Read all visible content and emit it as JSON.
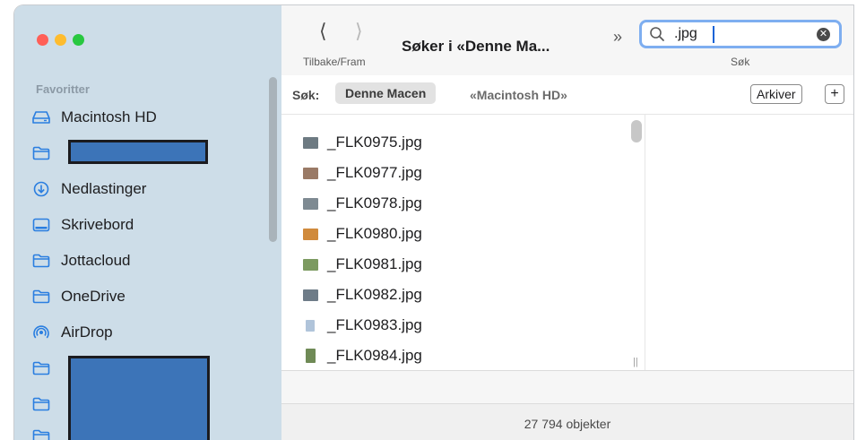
{
  "window": {
    "title": "Søker i «Denne Ma...",
    "nav_label": "Tilbake/Fram",
    "overflow_glyph": "»"
  },
  "search": {
    "query": ".jpg",
    "label": "Søk"
  },
  "scope": {
    "label": "Søk:",
    "active": "Denne Macen",
    "alt": "«Macintosh HD»",
    "save_button": "Arkiver",
    "add_button": "+"
  },
  "sidebar": {
    "header": "Favoritter",
    "items": [
      {
        "label": "Macintosh HD",
        "icon": "drive-icon"
      },
      {
        "label": "",
        "icon": "folder-icon"
      },
      {
        "label": "Nedlastinger",
        "icon": "download-icon"
      },
      {
        "label": "Skrivebord",
        "icon": "desktop-icon"
      },
      {
        "label": "Jottacloud",
        "icon": "folder-icon"
      },
      {
        "label": "OneDrive",
        "icon": "folder-icon"
      },
      {
        "label": "AirDrop",
        "icon": "airdrop-icon"
      },
      {
        "label": "",
        "icon": "folder-icon"
      },
      {
        "label": "",
        "icon": "folder-icon"
      },
      {
        "label": "",
        "icon": "folder-icon"
      }
    ]
  },
  "files": [
    {
      "name": "_FLK0975.jpg",
      "thumb_color": "#6d7a82"
    },
    {
      "name": "_FLK0977.jpg",
      "thumb_color": "#9a7a66"
    },
    {
      "name": "_FLK0978.jpg",
      "thumb_color": "#7e8a92"
    },
    {
      "name": "_FLK0980.jpg",
      "thumb_color": "#d08a3c"
    },
    {
      "name": "_FLK0981.jpg",
      "thumb_color": "#7c9a60"
    },
    {
      "name": "_FLK0982.jpg",
      "thumb_color": "#6e7c88"
    },
    {
      "name": "_FLK0983.jpg",
      "thumb_color": "#b0c4da"
    },
    {
      "name": "_FLK0984.jpg",
      "thumb_color": "#6f8a56"
    }
  ],
  "status": {
    "count": "27 794 objekter"
  },
  "colors": {
    "sidebar_bg": "#cddde8",
    "accent": "#2a7ee0",
    "search_focus": "#7eaef0",
    "redaction": "#3c74b8"
  }
}
